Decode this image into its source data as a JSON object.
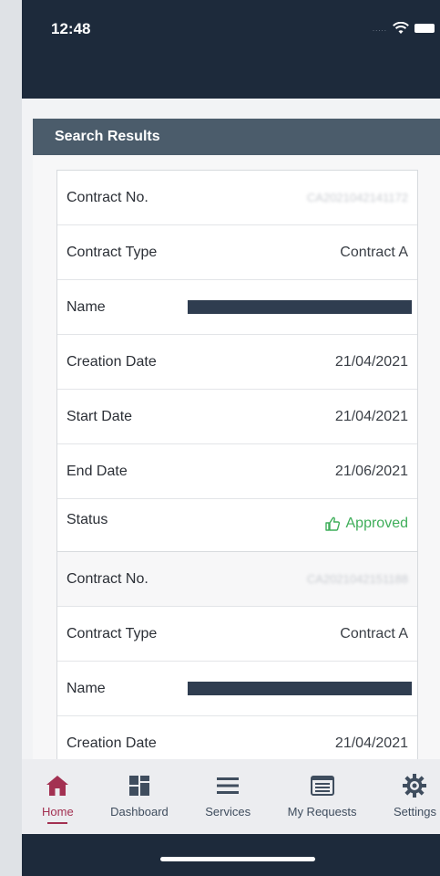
{
  "status_bar": {
    "time": "12:48",
    "signal_dots": "....."
  },
  "header": {
    "title": "Search Results"
  },
  "results": [
    {
      "rows": [
        {
          "label": "Contract No.",
          "value": "CA2021042141172",
          "blurred": true
        },
        {
          "label": "Contract Type",
          "value": "Contract A"
        },
        {
          "label": "Name",
          "value": "",
          "redacted": true
        },
        {
          "label": "Creation Date",
          "value": "21/04/2021"
        },
        {
          "label": "Start Date",
          "value": "21/04/2021"
        },
        {
          "label": "End Date",
          "value": "21/06/2021"
        },
        {
          "label": "Status",
          "value": "Approved",
          "icon": "thumbs-up-icon"
        }
      ]
    },
    {
      "rows": [
        {
          "label": "Contract No.",
          "value": "CA2021042151188",
          "blurred": true
        },
        {
          "label": "Contract Type",
          "value": "Contract A"
        },
        {
          "label": "Name",
          "value": "",
          "redacted": true
        },
        {
          "label": "Creation Date",
          "value": "21/04/2021"
        }
      ]
    }
  ],
  "tabs": [
    {
      "label": "Home",
      "icon": "home-icon",
      "active": true
    },
    {
      "label": "Dashboard",
      "icon": "dashboard-icon",
      "active": false
    },
    {
      "label": "Services",
      "icon": "menu-icon",
      "active": false
    },
    {
      "label": "My Requests",
      "icon": "requests-icon",
      "active": false
    },
    {
      "label": "Settings",
      "icon": "gear-icon",
      "active": false
    }
  ],
  "colors": {
    "navy": "#1d2a3b",
    "header": "#4b5c6b",
    "approved": "#3fae5a",
    "active_tab": "#a33152",
    "inactive_tab": "#3f4d5e"
  }
}
